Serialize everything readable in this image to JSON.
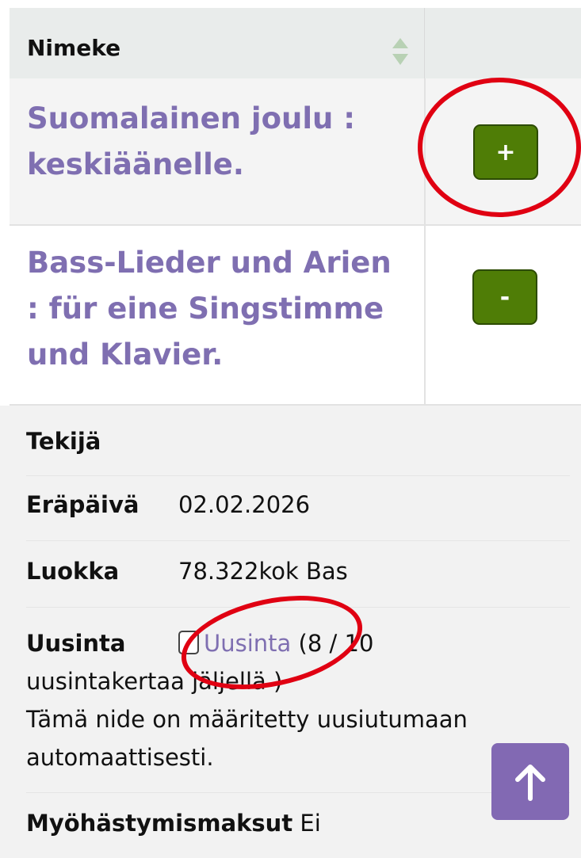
{
  "table": {
    "header": {
      "title": "Nimeke"
    },
    "rows": [
      {
        "title": "Suomalainen joulu : keskiäänelle.",
        "button_label": "+"
      },
      {
        "title": "Bass-Lieder und Arien : für eine Singstimme und Klavier.",
        "button_label": "-"
      }
    ]
  },
  "details": {
    "author_label": "Tekijä",
    "due_label": "Eräpäivä",
    "due_value": "02.02.2026",
    "class_label": "Luokka",
    "class_value": "78.322kok Bas",
    "renew_label": "Uusinta",
    "renew_link": "Uusinta",
    "renew_count_prefix": "(",
    "renew_count": "8 / 10",
    "renew_suffix": "uusintakertaa jäljellä )",
    "auto_note": "Tämä nide on määritetty uusiutumaan automaattisesti.",
    "fines_label": "Myöhästymismaksut",
    "fines_value": "Ei"
  },
  "icons": {
    "sort": "sort-arrows-icon",
    "scroll_top": "arrow-up-icon"
  },
  "colors": {
    "accent": "#7f6fb1",
    "button_green": "#4f7d06",
    "annotation_red": "#e00012"
  }
}
